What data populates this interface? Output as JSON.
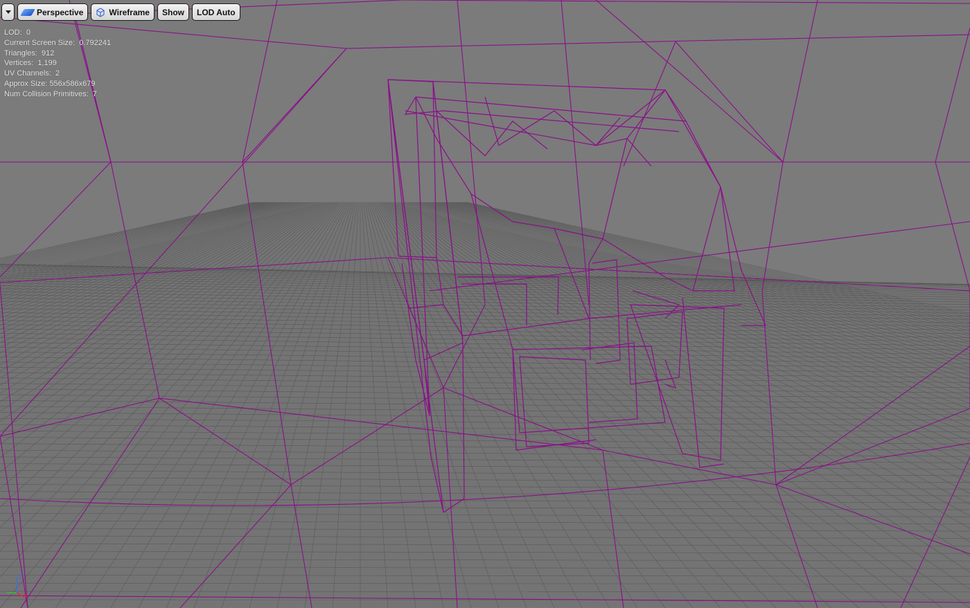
{
  "toolbar": {
    "menu_icon": "dropdown-arrow",
    "perspective_label": "Perspective",
    "wireframe_label": "Wireframe",
    "show_label": "Show",
    "lod_label": "LOD Auto"
  },
  "stats": [
    {
      "label": "LOD:",
      "value": "0"
    },
    {
      "label": "Current Screen Size:",
      "value": "0.792241"
    },
    {
      "label": "Triangles:",
      "value": "912"
    },
    {
      "label": "Vertices:",
      "value": "1,199"
    },
    {
      "label": "UV Channels:",
      "value": "2"
    },
    {
      "label": "Approx Size:",
      "value": "556x586x679"
    },
    {
      "label": "Num Collision Primitives:",
      "value": "7"
    }
  ],
  "axis_gizmo": {
    "x": "X",
    "y": "Y",
    "z": "Z"
  },
  "colors": {
    "background": "#7b7b7b",
    "wireframe": "#8a0f8a",
    "floor_grid": "#595959",
    "axis_x": "#e03030",
    "axis_y": "#30c030",
    "axis_z": "#3a6ee8"
  }
}
